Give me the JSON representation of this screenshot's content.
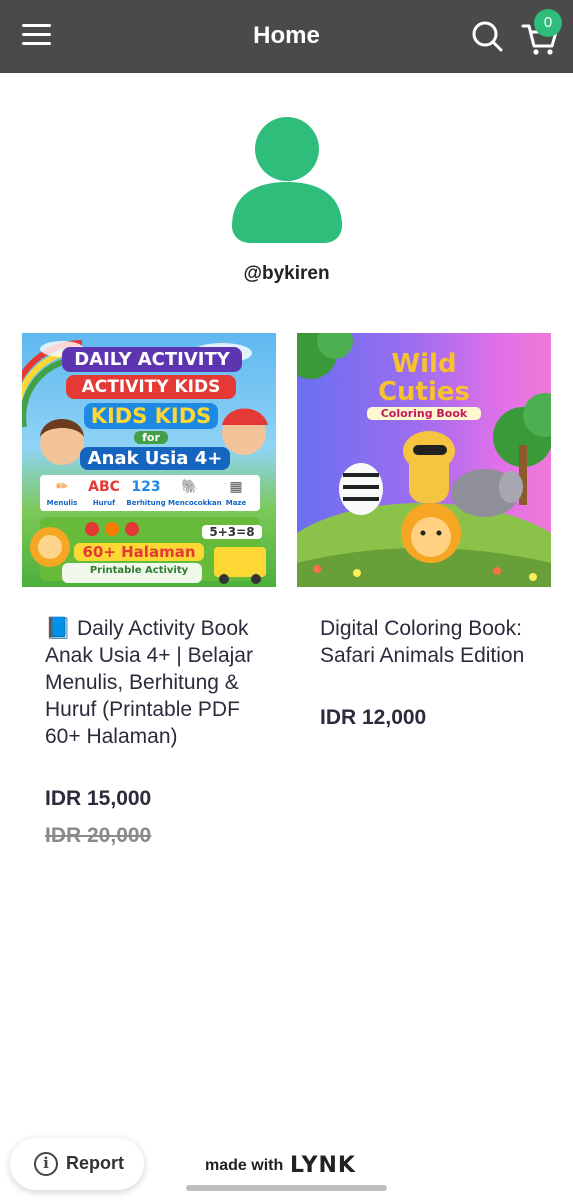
{
  "header": {
    "title": "Home",
    "cart_count": "0"
  },
  "profile": {
    "username": "@bykiren"
  },
  "products": [
    {
      "title": "📘 Daily Activity Book Anak Usia 4+ | Belajar Menulis, Berhitung & Huruf (Printable PDF 60+ Halaman)",
      "price": "IDR 15,000",
      "original_price": "IDR 20,000",
      "cover": {
        "line1": "DAILY ACTIVITY",
        "line2": "ACTIVITY KIDS",
        "line3": "KIDS KIDS",
        "line4": "for",
        "line5": "Anak Usia 4+",
        "tiles": [
          "Menulis",
          "Huruf",
          "Berhitung",
          "Mencocokkan",
          "Maze"
        ],
        "tile_glyphs": [
          "✏",
          "ABC",
          "123",
          "🐘",
          "▦"
        ],
        "banner1": "60+ Halaman",
        "banner2": "Printable Activity",
        "equation": "5+3=8"
      }
    },
    {
      "title": "Digital Coloring Book: Safari Animals Edition",
      "price": "IDR 12,000",
      "cover": {
        "line1": "Wild",
        "line2": "Cuties",
        "line3": "Coloring Book"
      }
    }
  ],
  "footer": {
    "report_label": "Report",
    "made_with": "made with",
    "brand": "LYNK"
  },
  "colors": {
    "header_bg": "#4a4a4a",
    "accent_green": "#2ebd7a",
    "text_dark": "#2b2b3c"
  }
}
